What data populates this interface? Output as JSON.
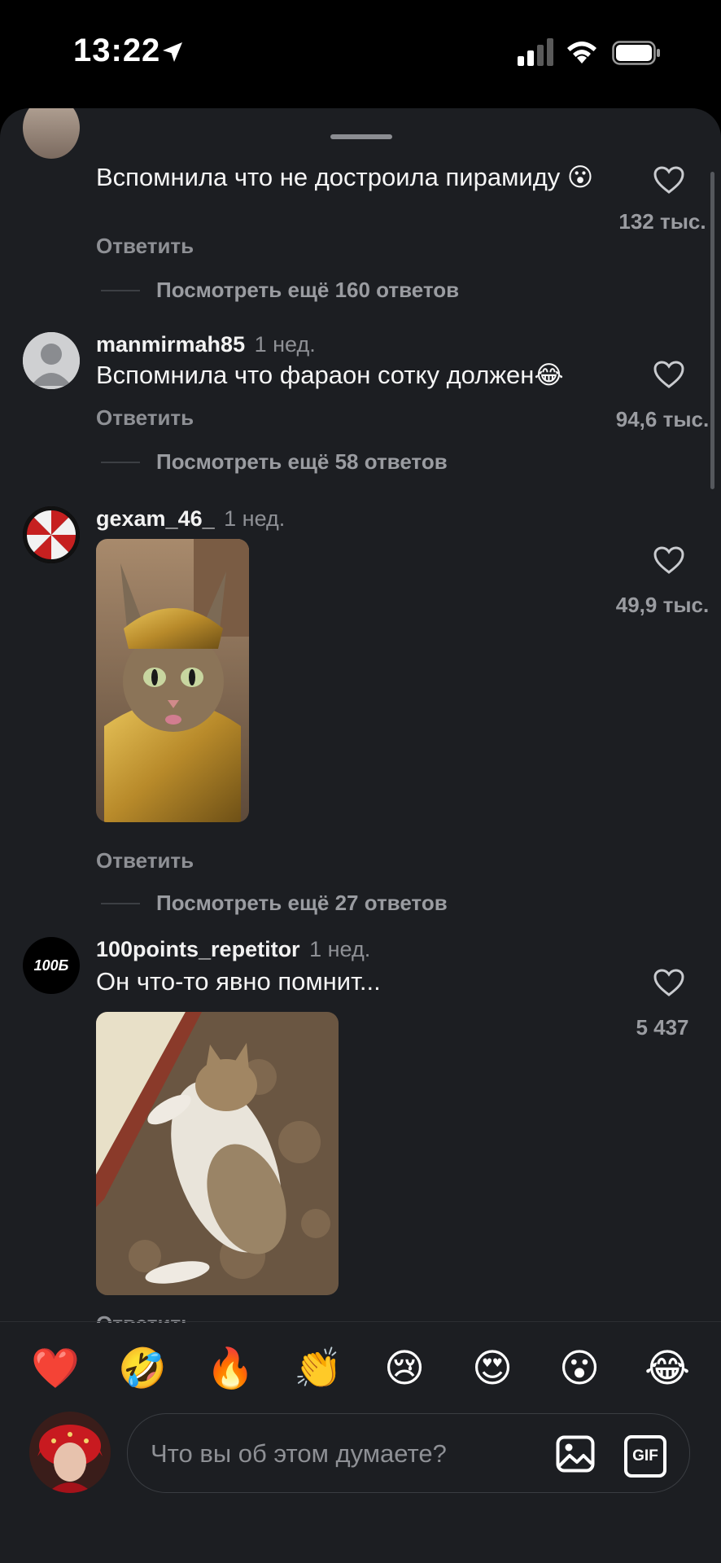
{
  "status_bar": {
    "time": "13:22"
  },
  "comments": [
    {
      "user": "",
      "time": "",
      "text": "Вспомнила что не достроила пирамиду 😮",
      "reply_label": "Ответить",
      "likes": "132 тыс.",
      "more_replies": "Посмотреть ещё 160 ответов"
    },
    {
      "user": "manmirmah85",
      "time": "1 нед.",
      "text": "Вспомнила что фараон сотку должен😂",
      "reply_label": "Ответить",
      "likes": "94,6 тыс.",
      "more_replies": "Посмотреть ещё 58 ответов"
    },
    {
      "user": "gexam_46_",
      "time": "1 нед.",
      "text": "",
      "reply_label": "Ответить",
      "likes": "49,9 тыс.",
      "more_replies": "Посмотреть ещё 27 ответов"
    },
    {
      "user": "100points_repetitor",
      "time": "1 нед.",
      "avatar_text": "100Б",
      "text": "Он что-то явно помнит...",
      "reply_label": "Ответить",
      "likes": "5 437"
    }
  ],
  "reactions": [
    "❤️",
    "🤣",
    "🔥",
    "👏",
    "😢",
    "😍",
    "😮",
    "😂"
  ],
  "composer": {
    "placeholder": "Что вы об этом думаете?",
    "gif_label": "GIF"
  },
  "colors": {
    "sheet_bg": "#1c1e22",
    "muted": "#8e9095"
  }
}
